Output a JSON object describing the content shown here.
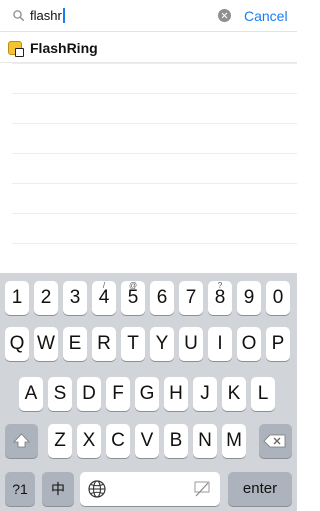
{
  "search": {
    "query": "flashr",
    "cancel_label": "Cancel"
  },
  "results": [
    {
      "label": "FlashRing",
      "icon": "flashring-app-icon"
    }
  ],
  "keyboard": {
    "numbers": [
      {
        "main": "1",
        "sub": ""
      },
      {
        "main": "2",
        "sub": ""
      },
      {
        "main": "3",
        "sub": ""
      },
      {
        "main": "4",
        "sub": "/"
      },
      {
        "main": "5",
        "sub": "@"
      },
      {
        "main": "6",
        "sub": ""
      },
      {
        "main": "7",
        "sub": ""
      },
      {
        "main": "8",
        "sub": "?"
      },
      {
        "main": "9",
        "sub": ""
      },
      {
        "main": "0",
        "sub": ""
      }
    ],
    "row_q": [
      "Q",
      "W",
      "E",
      "R",
      "T",
      "Y",
      "U",
      "I",
      "O",
      "P"
    ],
    "row_a": [
      "A",
      "S",
      "D",
      "F",
      "G",
      "H",
      "J",
      "K",
      "L"
    ],
    "row_z": [
      "Z",
      "X",
      "C",
      "V",
      "B",
      "N",
      "M"
    ],
    "mode_label": "?1",
    "lang_label": "中",
    "enter_label": "enter"
  },
  "colors": {
    "accent": "#1b7cf2",
    "keyboard_bg": "#d1d4d9",
    "key_dark": "#adb3bc",
    "app_icon": "#f4c430"
  }
}
